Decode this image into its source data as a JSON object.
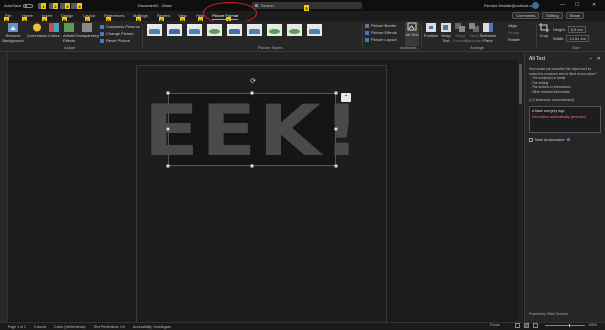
{
  "titlebar": {
    "autosave_label": "AutoSave",
    "doc_title": "Document2 - Word",
    "search_placeholder": "Search",
    "user_name": "Renske.Neulab@outlook.com",
    "minimize": "—",
    "maximize": "☐",
    "close": "✕"
  },
  "tabs": {
    "file": "File",
    "home": "Home",
    "insert": "Insert",
    "design": "Design",
    "layout": "Layout",
    "references": "References",
    "mailings": "Mailings",
    "review": "Review",
    "view": "View",
    "help": "Help",
    "picture_format": "Picture Format",
    "comments": "Comments",
    "editing": "Editing",
    "share": "Share"
  },
  "ribbon": {
    "remove_background": "Remove Background",
    "corrections": "Corrections",
    "color": "Colour",
    "artistic_effects": "Artistic Effects",
    "transparency": "Transparency",
    "compress_pictures": "Compress Pictures",
    "change_picture": "Change Picture",
    "reset_picture": "Reset Picture",
    "adjust_group": "Adjust",
    "picture_styles_group": "Picture Styles",
    "picture_border": "Picture Border",
    "picture_effects": "Picture Effects",
    "picture_layout": "Picture Layout",
    "accessibility_group": "Accessib...",
    "alt_text": "Alt Text",
    "position": "Position",
    "wrap_text": "Wrap Text",
    "bring_forward": "Bring Forward",
    "send_backward": "Send Backward",
    "selection_pane": "Selection Pane",
    "arrange_group": "Arrange",
    "align": "Align",
    "group": "Group",
    "rotate": "Rotate",
    "crop": "Crop",
    "height_label": "Height:",
    "height_value": "6,5 cm",
    "width_label": "Width:",
    "width_value": "14,51 cm",
    "size_group": "Size"
  },
  "badges": [
    "1",
    "2",
    "3",
    "4",
    "5",
    "6",
    "7",
    "8",
    "9",
    "A",
    "B",
    "C",
    "D",
    "E",
    "F",
    "G",
    "H",
    "I",
    "J",
    "K",
    "L",
    "M",
    "N",
    "P",
    "Q",
    "R",
    "S",
    "T"
  ],
  "image": {
    "text": "EEK!",
    "layout_options": "⌃"
  },
  "alt_text_pane": {
    "title": "Alt Text",
    "close": "✕",
    "menu": "⌄",
    "question": "How would you describe this object and its context to someone who is blind or low vision?",
    "list": [
      "- The subject(s) in detail",
      "- The setting",
      "- The actions or interactions",
      "- Other relevant information"
    ],
    "count": "(1-2 sentences recommended)",
    "alt_value": "A black and grey logo",
    "alt_note": "Description automatically generated",
    "mark_decorative": "Mark as decorative",
    "powered_by": "Powered by Office Services"
  },
  "statusbar": {
    "page": "Page 1 of 1",
    "words": "0 words",
    "language": "Dutch (Netherlands)",
    "text_predictions": "Text Predictions: On",
    "accessibility": "Accessibility: Investigate",
    "focus": "Focus",
    "zoom": "100%"
  }
}
